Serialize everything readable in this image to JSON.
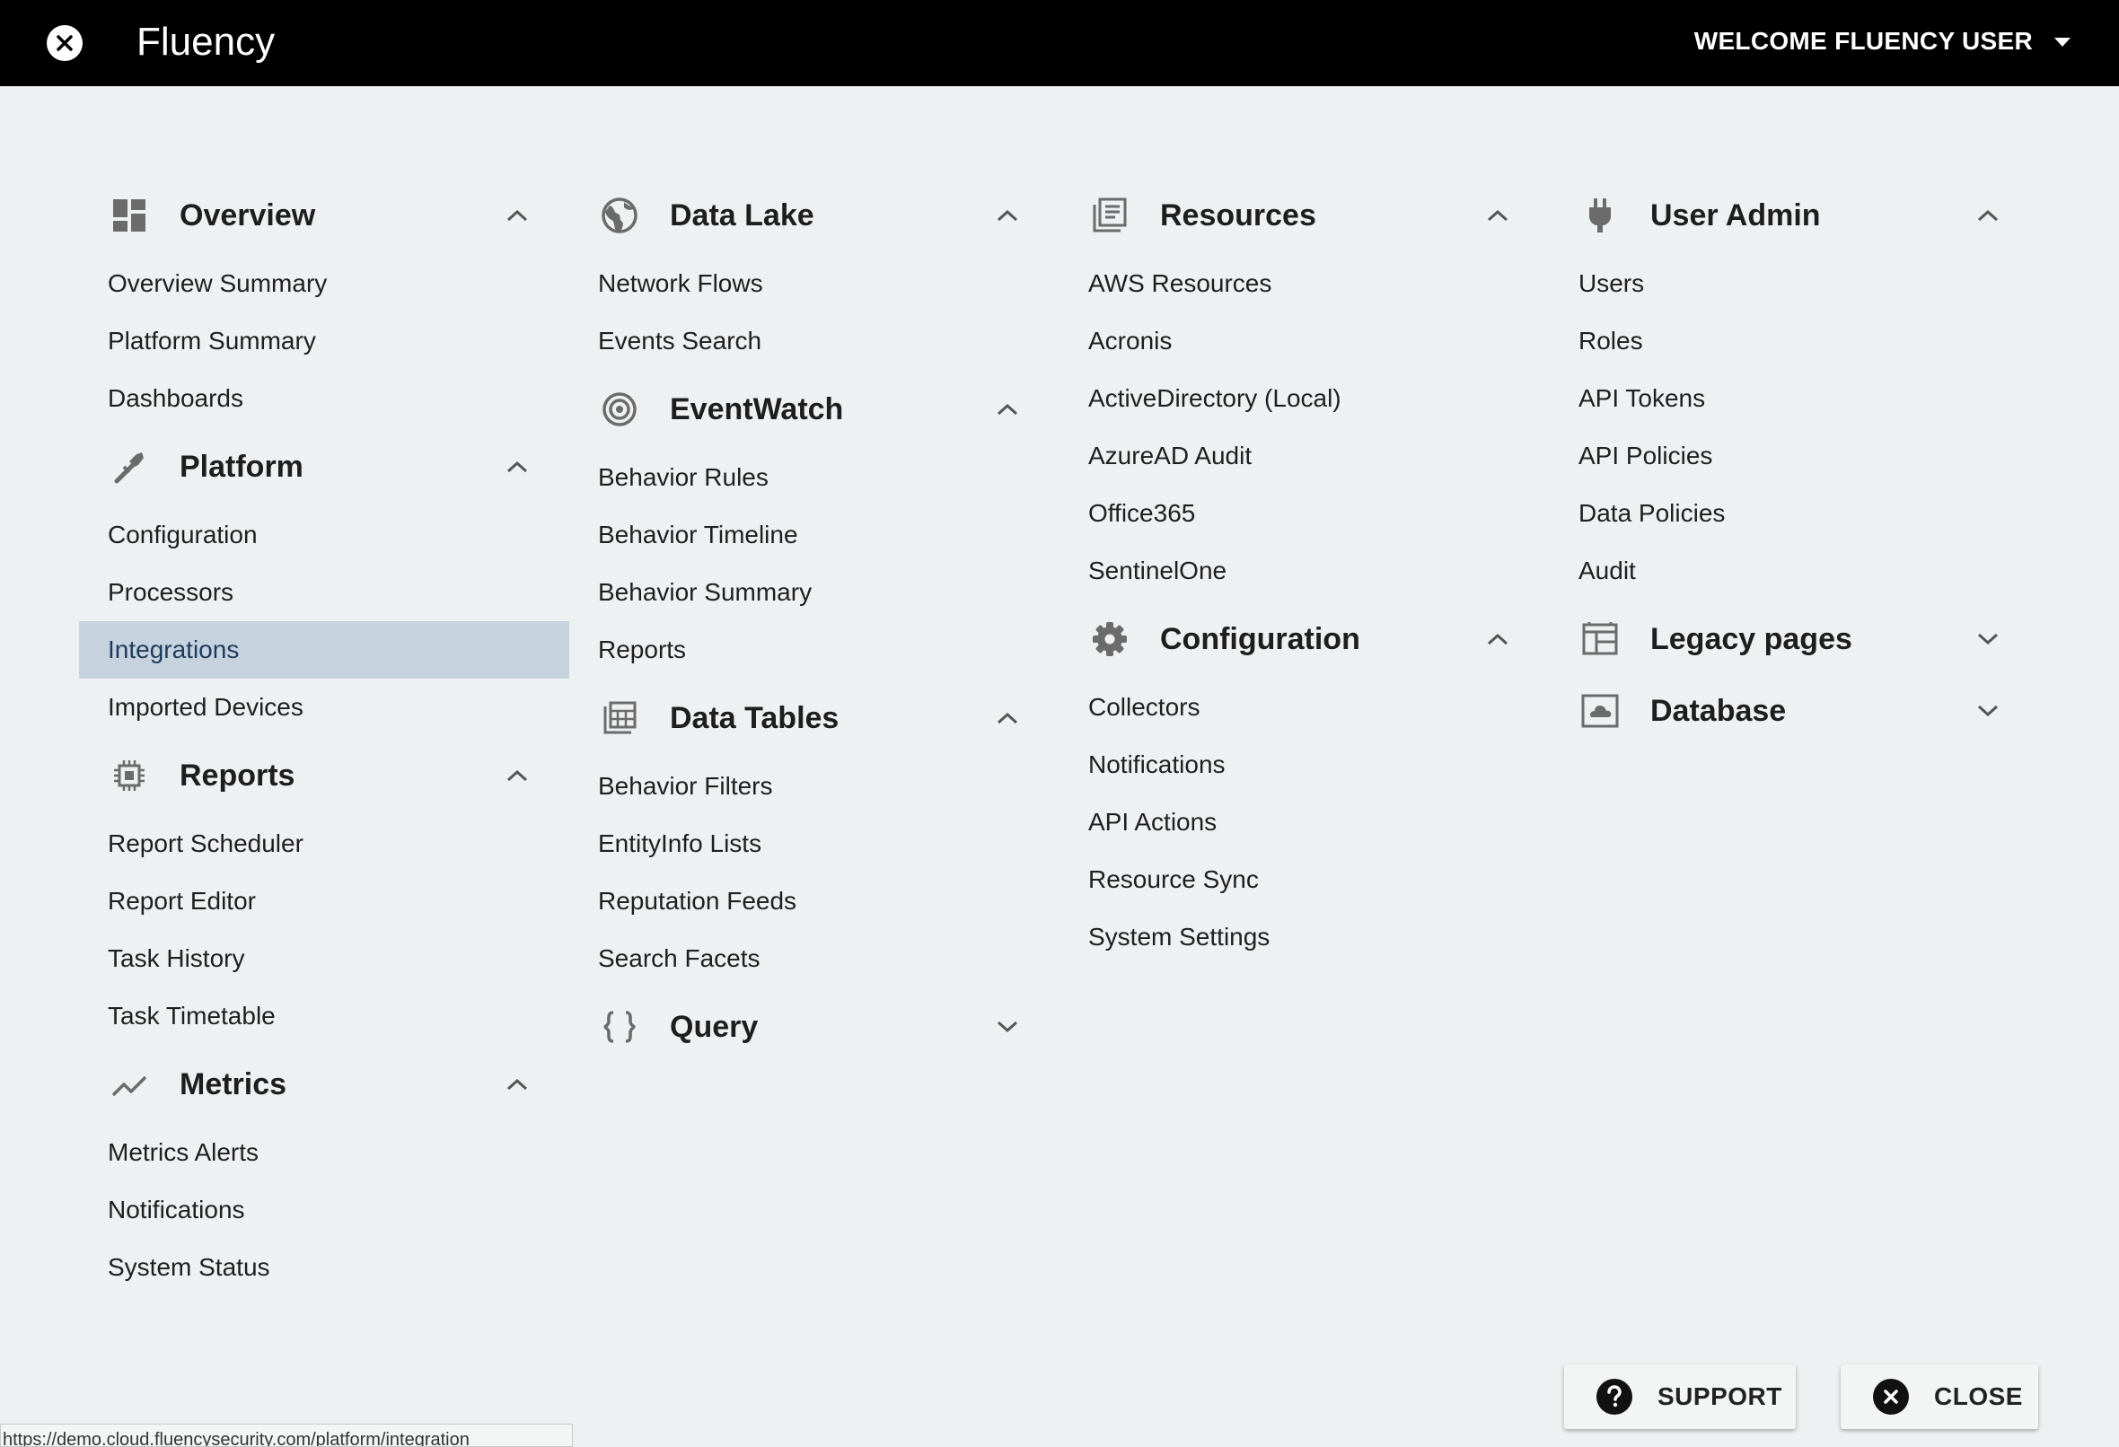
{
  "header": {
    "app_title": "Fluency",
    "welcome": "WELCOME FLUENCY USER"
  },
  "columns": {
    "c1": {
      "overview": {
        "title": "Overview",
        "items": [
          "Overview Summary",
          "Platform Summary",
          "Dashboards"
        ]
      },
      "platform": {
        "title": "Platform",
        "items": [
          "Configuration",
          "Processors",
          "Integrations",
          "Imported Devices"
        ]
      },
      "reports": {
        "title": "Reports",
        "items": [
          "Report Scheduler",
          "Report Editor",
          "Task History",
          "Task Timetable"
        ]
      },
      "metrics": {
        "title": "Metrics",
        "items": [
          "Metrics Alerts",
          "Notifications",
          "System Status"
        ]
      }
    },
    "c2": {
      "datalake": {
        "title": "Data Lake",
        "items": [
          "Network Flows",
          "Events Search"
        ]
      },
      "eventwatch": {
        "title": "EventWatch",
        "items": [
          "Behavior Rules",
          "Behavior Timeline",
          "Behavior Summary",
          "Reports"
        ]
      },
      "datatables": {
        "title": "Data Tables",
        "items": [
          "Behavior Filters",
          "EntityInfo Lists",
          "Reputation Feeds",
          "Search Facets"
        ]
      },
      "query": {
        "title": "Query"
      }
    },
    "c3": {
      "resources": {
        "title": "Resources",
        "items": [
          "AWS Resources",
          "Acronis",
          "ActiveDirectory (Local)",
          "AzureAD Audit",
          "Office365",
          "SentinelOne"
        ]
      },
      "configuration": {
        "title": "Configuration",
        "items": [
          "Collectors",
          "Notifications",
          "API Actions",
          "Resource Sync",
          "System Settings"
        ]
      }
    },
    "c4": {
      "useradmin": {
        "title": "User Admin",
        "items": [
          "Users",
          "Roles",
          "API Tokens",
          "API Policies",
          "Data Policies",
          "Audit"
        ]
      },
      "legacy": {
        "title": "Legacy pages"
      },
      "database": {
        "title": "Database"
      }
    }
  },
  "footer": {
    "support_label": "SUPPORT",
    "close_label": "CLOSE",
    "status_url": "https://demo.cloud.fluencysecurity.com/platform/integration"
  },
  "colors": {
    "topbar": "#000000",
    "background": "#eef1f1",
    "active_item": "#c7d2df",
    "icon_gray": "#6b6b6b"
  },
  "active_item": "Integrations"
}
